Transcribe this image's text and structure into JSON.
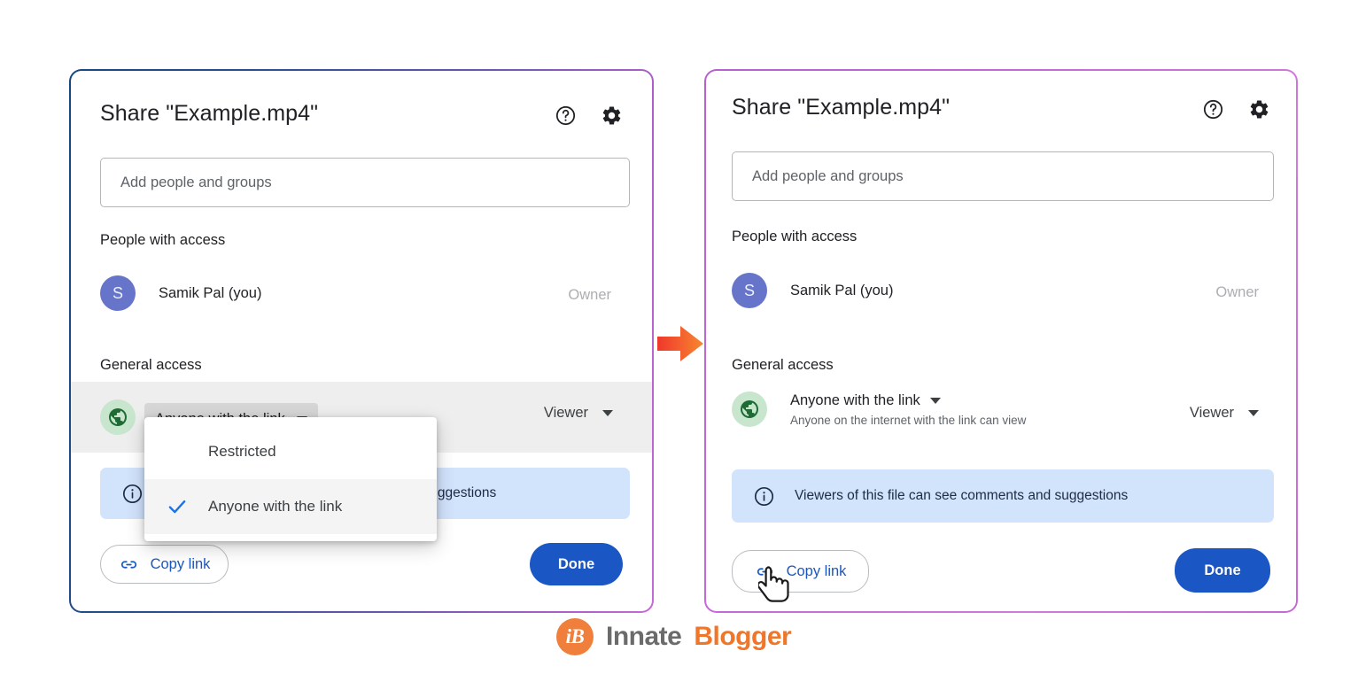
{
  "panels": {
    "left": {
      "title": "Share \"Example.mp4\"",
      "help_icon": "help-circle-icon",
      "settings_icon": "gear-icon",
      "add_people_placeholder": "Add people and groups",
      "people_section_label": "People with access",
      "person": {
        "avatar_initial": "S",
        "name": "Samik Pal (you)",
        "role": "Owner"
      },
      "general_access_label": "General access",
      "access_trigger_label": "Anyone with the link",
      "role_label": "Viewer",
      "info_text": "Viewers of this file can see comments and suggestions",
      "copy_link_label": "Copy link",
      "done_label": "Done",
      "dropdown": {
        "options": [
          {
            "label": "Restricted",
            "selected": false
          },
          {
            "label": "Anyone with the link",
            "selected": true
          }
        ]
      }
    },
    "right": {
      "title": "Share \"Example.mp4\"",
      "help_icon": "help-circle-icon",
      "settings_icon": "gear-icon",
      "add_people_placeholder": "Add people and groups",
      "people_section_label": "People with access",
      "person": {
        "avatar_initial": "S",
        "name": "Samik Pal (you)",
        "role": "Owner"
      },
      "general_access_label": "General access",
      "access_label": "Anyone with the link",
      "access_sublabel": "Anyone on the internet with the link can view",
      "role_label": "Viewer",
      "info_text": "Viewers of this file can see comments and suggestions",
      "copy_link_label": "Copy link",
      "done_label": "Done"
    }
  },
  "flow_arrow_icon": "right-arrow-icon",
  "cursor_icon": "pointing-hand-cursor",
  "logo": {
    "mark": "iB",
    "word1": "Innate",
    "word2": "Blogger"
  },
  "colors": {
    "primary_blue": "#1a56c4",
    "info_bg": "#d2e3fc",
    "avatar_bg": "#6674ca",
    "globe_bg": "#c8e6cd",
    "accent_orange": "#f0762a",
    "left_border_start": "#14497f",
    "border_purple": "#c46bd6"
  }
}
